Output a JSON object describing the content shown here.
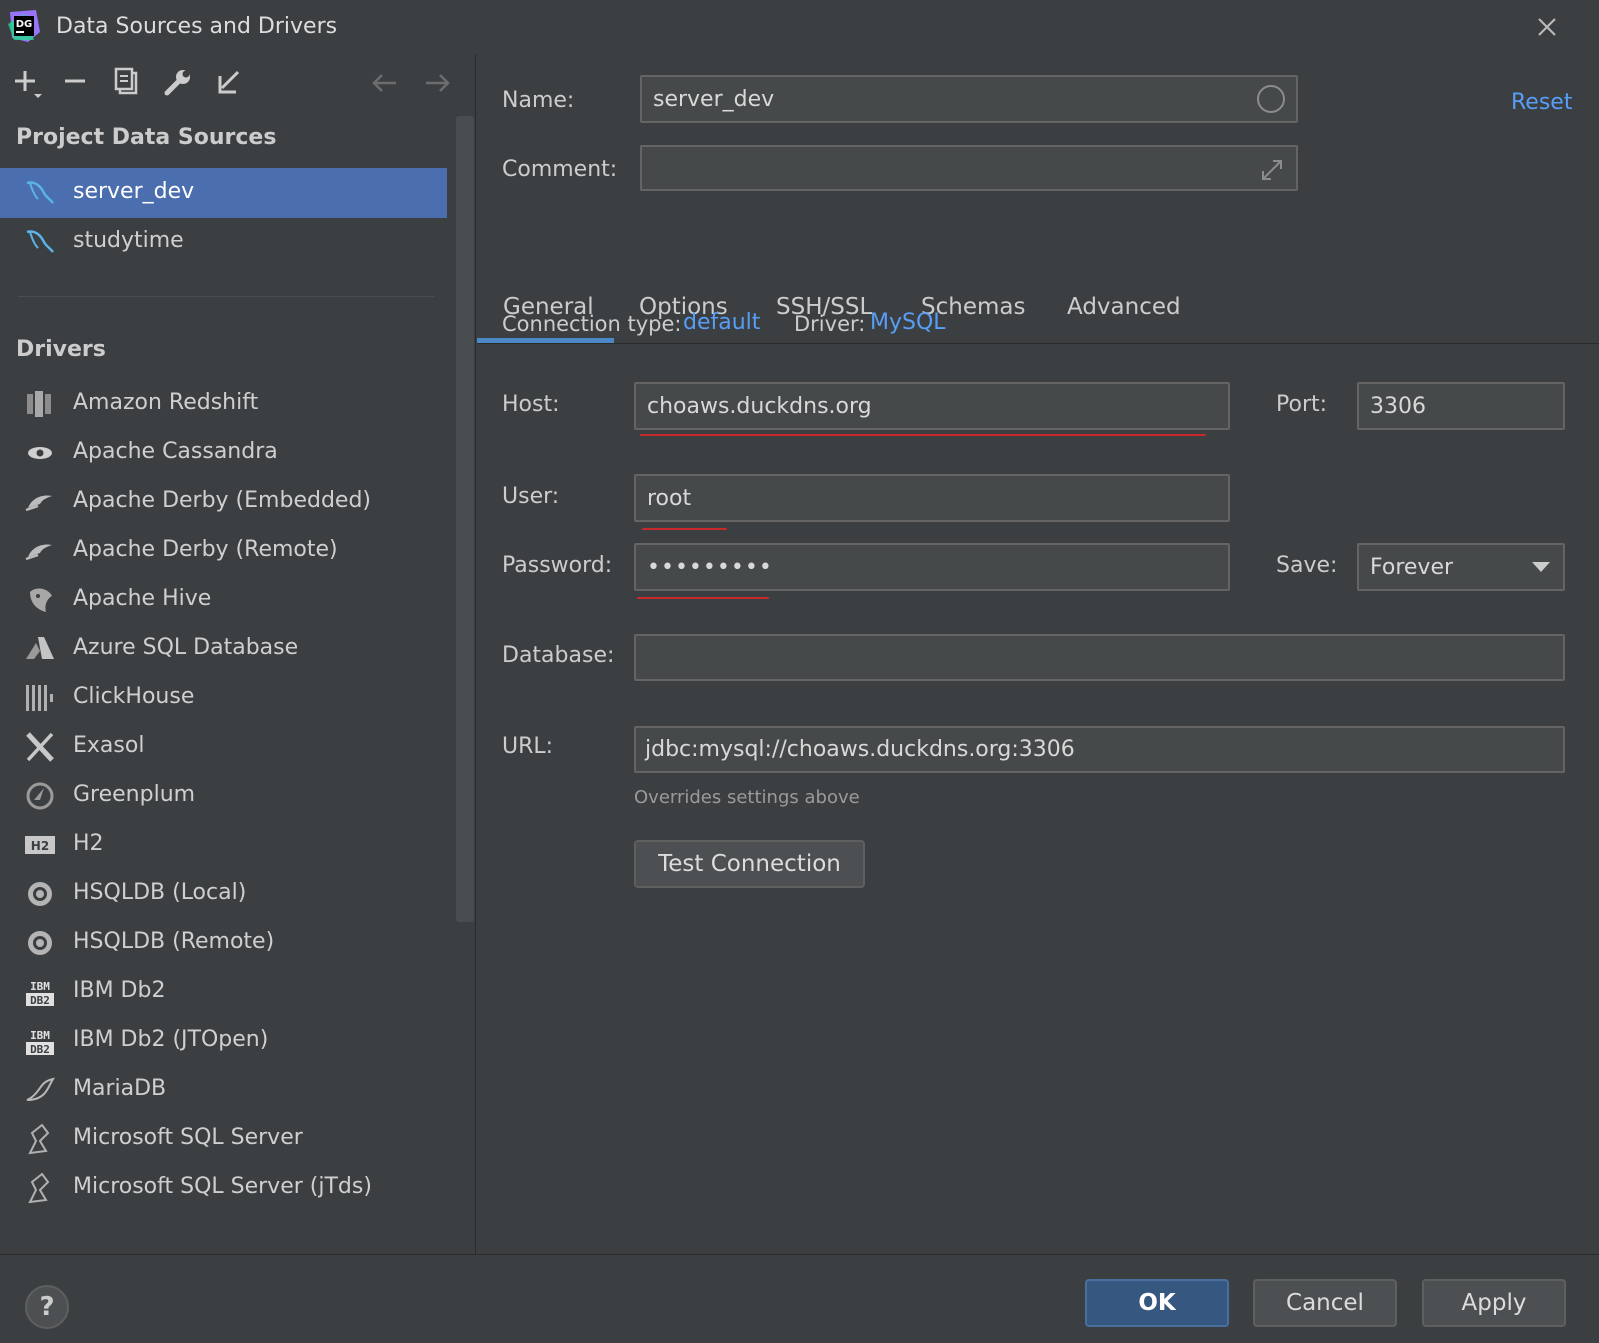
{
  "window": {
    "title": "Data Sources and Drivers",
    "logo_text": "DG"
  },
  "sidebar": {
    "project_heading": "Project Data Sources",
    "data_sources": [
      {
        "label": "server_dev",
        "icon": "mysql-icon",
        "selected": true
      },
      {
        "label": "studytime",
        "icon": "mysql-icon",
        "selected": false
      }
    ],
    "drivers_heading": "Drivers",
    "drivers": [
      {
        "label": "Amazon Redshift",
        "icon": "redshift-icon"
      },
      {
        "label": "Apache Cassandra",
        "icon": "cassandra-icon"
      },
      {
        "label": "Apache Derby (Embedded)",
        "icon": "derby-icon"
      },
      {
        "label": "Apache Derby (Remote)",
        "icon": "derby-icon"
      },
      {
        "label": "Apache Hive",
        "icon": "hive-icon"
      },
      {
        "label": "Azure SQL Database",
        "icon": "azure-icon"
      },
      {
        "label": "ClickHouse",
        "icon": "clickhouse-icon"
      },
      {
        "label": "Exasol",
        "icon": "exasol-icon"
      },
      {
        "label": "Greenplum",
        "icon": "greenplum-icon"
      },
      {
        "label": "H2",
        "icon": "h2-icon",
        "icon_text": "H2"
      },
      {
        "label": "HSQLDB (Local)",
        "icon": "hsqldb-icon"
      },
      {
        "label": "HSQLDB (Remote)",
        "icon": "hsqldb-icon"
      },
      {
        "label": "IBM Db2",
        "icon": "db2-icon",
        "icon_text_top": "IBM",
        "icon_text_bottom": "DB2"
      },
      {
        "label": "IBM Db2 (JTOpen)",
        "icon": "db2-icon",
        "icon_text_top": "IBM",
        "icon_text_bottom": "DB2"
      },
      {
        "label": "MariaDB",
        "icon": "mariadb-icon"
      },
      {
        "label": "Microsoft SQL Server",
        "icon": "mssql-icon"
      },
      {
        "label": "Microsoft SQL Server (jTds)",
        "icon": "mssql-icon"
      }
    ]
  },
  "form": {
    "name_label": "Name:",
    "name_value": "server_dev",
    "comment_label": "Comment:",
    "comment_value": "",
    "reset_label": "Reset",
    "tabs": [
      "General",
      "Options",
      "SSH/SSL",
      "Schemas",
      "Advanced"
    ],
    "active_tab": "General",
    "connection_type_label": "Connection type:",
    "connection_type_value": "default",
    "driver_label": "Driver:",
    "driver_value": "MySQL",
    "host_label": "Host:",
    "host_value": "choaws.duckdns.org",
    "port_label": "Port:",
    "port_value": "3306",
    "user_label": "User:",
    "user_value": "root",
    "password_label": "Password:",
    "password_value": "•••••••••",
    "save_label": "Save:",
    "save_value": "Forever",
    "database_label": "Database:",
    "database_value": "",
    "url_label": "URL:",
    "url_value": "jdbc:mysql://choaws.duckdns.org:3306",
    "url_hint": "Overrides settings above",
    "test_connection_label": "Test Connection"
  },
  "footer": {
    "help_label": "?",
    "ok_label": "OK",
    "cancel_label": "Cancel",
    "apply_label": "Apply"
  },
  "colors": {
    "background": "#3c3f41",
    "selection": "#4b6eaf",
    "link": "#589df6",
    "tab_underline": "#4a88c7",
    "annotation_underline": "#c82a2a",
    "primary_button": "#365880"
  }
}
